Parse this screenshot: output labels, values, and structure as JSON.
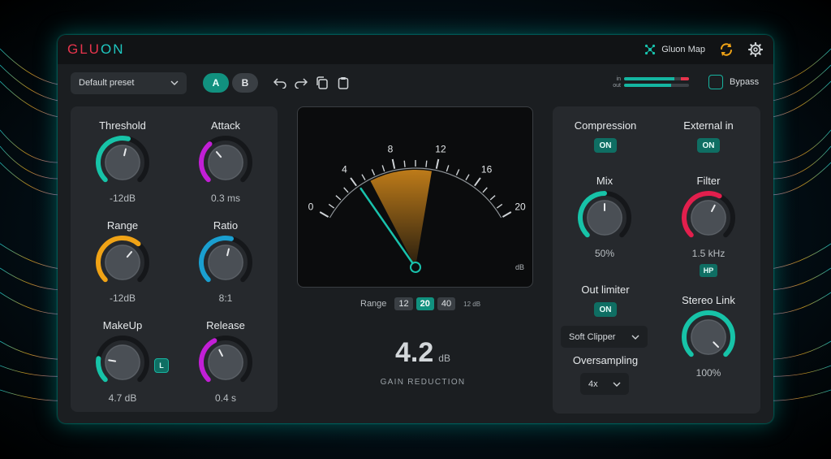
{
  "app": {
    "logo_left": "GLU",
    "logo_right": "ON"
  },
  "titlebar": {
    "gluon_map_label": "Gluon Map",
    "icons": [
      "gluon-map-icon",
      "sync-icon",
      "gear-icon"
    ]
  },
  "toolbar": {
    "preset_value": "Default preset",
    "ab_a": "A",
    "ab_b": "B",
    "meter_in_label": "in",
    "meter_out_label": "out",
    "meter_in_level": 0.78,
    "meter_out_level": 0.72,
    "bypass_label": "Bypass"
  },
  "left_panel": {
    "threshold": {
      "label": "Threshold",
      "value": "-12dB",
      "color": "#17c3a8",
      "level": 0.55
    },
    "attack": {
      "label": "Attack",
      "value": "0.3 ms",
      "color": "#c21fd6",
      "level": 0.35
    },
    "range": {
      "label": "Range",
      "value": "-12dB",
      "color": "#f0a316",
      "level": 0.65
    },
    "ratio": {
      "label": "Ratio",
      "value": "8:1",
      "color": "#1a9fd0",
      "level": 0.55
    },
    "makeup": {
      "label": "MakeUp",
      "value": "4.7 dB",
      "color": "#17c3a8",
      "level": 0.2,
      "badge": "L"
    },
    "release": {
      "label": "Release",
      "value": "0.4 s",
      "color": "#c21fd6",
      "level": 0.4
    }
  },
  "meter_screen": {
    "scale_labels": [
      "0",
      "4",
      "8",
      "12",
      "16",
      "20"
    ],
    "unit": "dB",
    "needle_value": 4.2,
    "range_label": "Range",
    "range_options": [
      "12",
      "20",
      "40"
    ],
    "range_selected": "20",
    "range_small": "12 dB",
    "gain_reduction_value": "4.2",
    "gain_reduction_unit": "dB",
    "gain_reduction_label": "GAIN REDUCTION"
  },
  "right_panel": {
    "compression_label": "Compression",
    "compression_state": "ON",
    "external_label": "External in",
    "external_state": "ON",
    "mix": {
      "label": "Mix",
      "value": "50%",
      "color": "#17c3a8",
      "level": 0.5
    },
    "filter": {
      "label": "Filter",
      "value": "1.5 kHz",
      "color": "#e21f4d",
      "level": 0.6,
      "hp": "HP"
    },
    "out_limiter_label": "Out limiter",
    "out_limiter_state": "ON",
    "clipper_value": "Soft Clipper",
    "oversampling_label": "Oversampling",
    "oversampling_value": "4x",
    "stereo": {
      "label": "Stereo Link",
      "value": "100%",
      "color": "#17c3a8",
      "level": 1.0
    }
  }
}
